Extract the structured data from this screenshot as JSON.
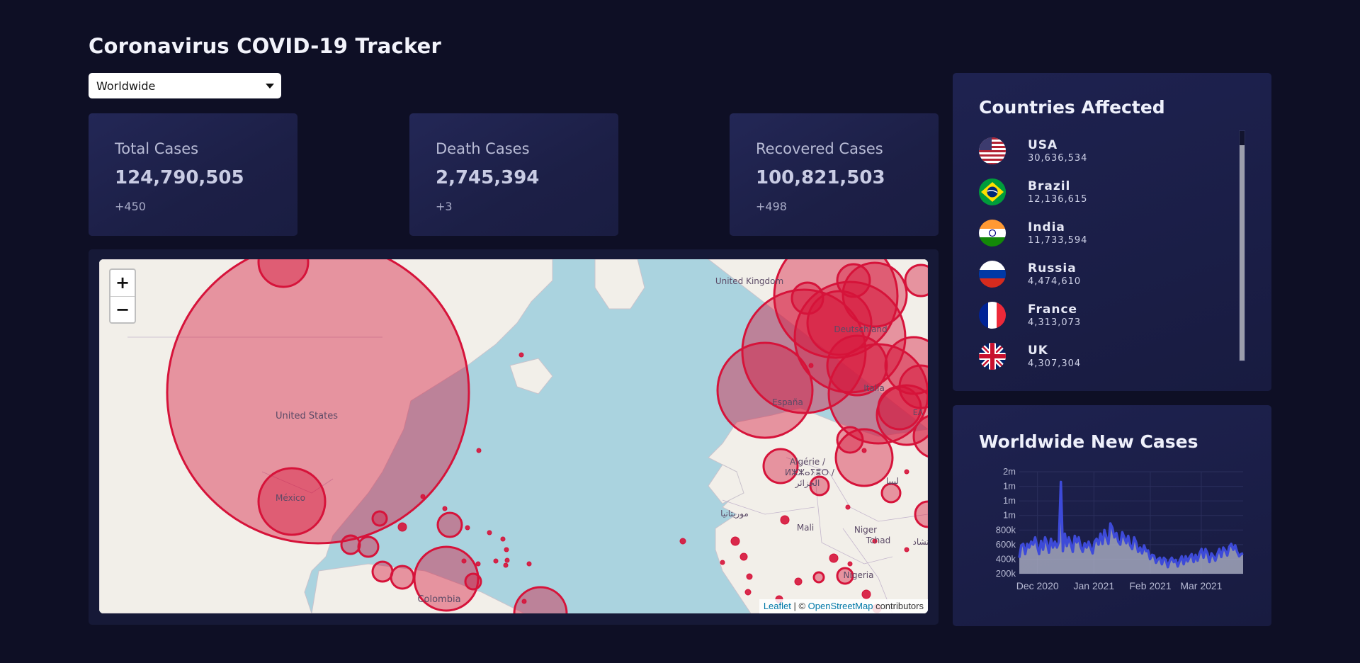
{
  "header": {
    "title": "Coronavirus COVID-19 Tracker"
  },
  "country_select": {
    "value": "Worldwide"
  },
  "stats": [
    {
      "label": "Total Cases",
      "value": "124,790,505",
      "change": "+450"
    },
    {
      "label": "Death Cases",
      "value": "2,745,394",
      "change": "+3"
    },
    {
      "label": "Recovered Cases",
      "value": "100,821,503",
      "change": "+498"
    }
  ],
  "map": {
    "labels": {
      "united_states": "United States",
      "mexico": "México",
      "colombia": "Colombia",
      "united_kingdom": "United Kingdom",
      "espana": "España",
      "italia": "Italia",
      "deutschland": "Deutschland",
      "algerie": "Algérie /",
      "algerie_tifinagh": "ⵍⵣⵣⴰⵢⴻⵔ /",
      "algerie_ar": "الجزائر",
      "mauritanie_ar": "موريتانيا",
      "mali": "Mali",
      "niger": "Niger",
      "tchad": "Tchad",
      "tchad_ar": "تشاد",
      "nigeria": "Nigeria",
      "libya_ar": "ليبيا",
      "greece_abbrev": "ΕΛ"
    },
    "zoom_in": "+",
    "zoom_out": "−",
    "attribution": {
      "leaflet": "Leaflet",
      "separator": " | © ",
      "osm": "OpenStreetMap",
      "suffix": " contributors"
    },
    "circle_color": "#d6133a"
  },
  "countries_affected": {
    "title": "Countries Affected",
    "items": [
      {
        "name": "USA",
        "count": "30,636,534",
        "flag": "usa-flag"
      },
      {
        "name": "Brazil",
        "count": "12,136,615",
        "flag": "brazil-flag"
      },
      {
        "name": "India",
        "count": "11,733,594",
        "flag": "india-flag"
      },
      {
        "name": "Russia",
        "count": "4,474,610",
        "flag": "russia-flag"
      },
      {
        "name": "France",
        "count": "4,313,073",
        "flag": "france-flag"
      },
      {
        "name": "UK",
        "count": "4,307,304",
        "flag": "uk-flag"
      }
    ]
  },
  "new_cases": {
    "title": "Worldwide New Cases"
  },
  "chart_data": {
    "type": "area",
    "title": "Worldwide New Cases",
    "x_tick_labels": [
      "Dec 2020",
      "Jan 2021",
      "Feb 2021",
      "Mar 2021"
    ],
    "y_tick_labels": [
      "2m",
      "1m",
      "1m",
      "1m",
      "800k",
      "600k",
      "400k",
      "200k"
    ],
    "ylim": [
      200000,
      1600000
    ],
    "x_start": "2020-11-21",
    "x_end": "2021-03-24",
    "values": [
      420000,
      590000,
      610000,
      470000,
      610000,
      560000,
      640000,
      600000,
      700000,
      580000,
      470000,
      650000,
      530000,
      700000,
      620000,
      490000,
      680000,
      560000,
      640000,
      560000,
      640000,
      1460000,
      510000,
      750000,
      580000,
      700000,
      610000,
      500000,
      720000,
      630000,
      700000,
      570000,
      500000,
      620000,
      560000,
      640000,
      560000,
      480000,
      640000,
      680000,
      600000,
      750000,
      610000,
      800000,
      700000,
      610000,
      890000,
      830000,
      700000,
      760000,
      640000,
      600000,
      770000,
      700000,
      620000,
      720000,
      590000,
      540000,
      700000,
      630000,
      500000,
      560000,
      480000,
      590000,
      510000,
      520000,
      400000,
      460000,
      450000,
      350000,
      400000,
      420000,
      330000,
      420000,
      390000,
      290000,
      380000,
      420000,
      360000,
      390000,
      300000,
      380000,
      440000,
      330000,
      440000,
      370000,
      430000,
      470000,
      360000,
      460000,
      380000,
      480000,
      540000,
      420000,
      540000,
      480000,
      360000,
      480000,
      440000,
      380000,
      470000,
      540000,
      430000,
      560000,
      520000,
      450000,
      570000,
      610000,
      530000,
      590000,
      500000,
      440000,
      470000,
      480000
    ],
    "colors": {
      "line": "#3d4ad8",
      "area": "rgba(175,180,200,0.78)"
    }
  }
}
